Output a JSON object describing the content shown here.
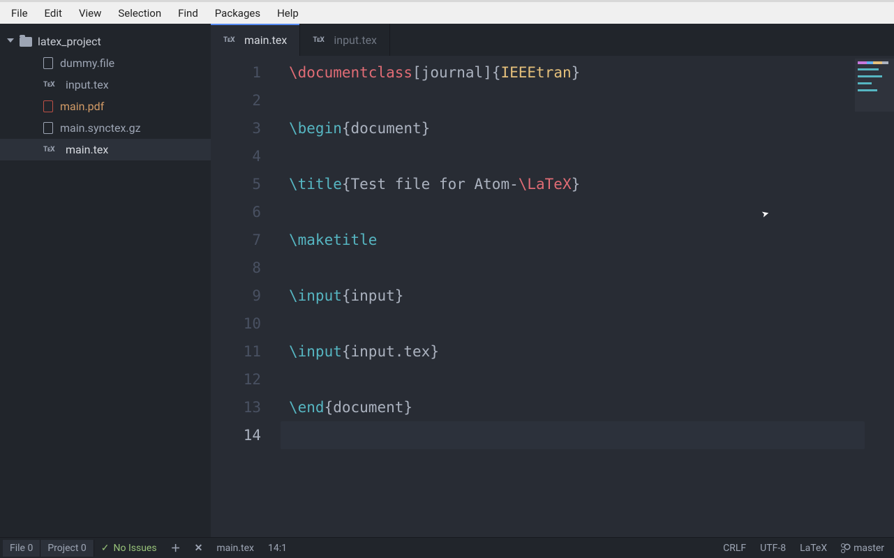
{
  "menubar": [
    "File",
    "Edit",
    "View",
    "Selection",
    "Find",
    "Packages",
    "Help"
  ],
  "sidebar": {
    "root": "latex_project",
    "files": [
      {
        "name": "dummy.file",
        "icon": "file",
        "selected": false
      },
      {
        "name": "input.tex",
        "icon": "tex",
        "selected": false
      },
      {
        "name": "main.pdf",
        "icon": "pdf",
        "selected": false
      },
      {
        "name": "main.synctex.gz",
        "icon": "gz",
        "selected": false
      },
      {
        "name": "main.tex",
        "icon": "tex",
        "selected": true
      }
    ]
  },
  "tabs": [
    {
      "label": "main.tex",
      "active": true
    },
    {
      "label": "input.tex",
      "active": false
    }
  ],
  "editor": {
    "tex_glyph": "TᴇX",
    "current_line": 14,
    "lines": [
      [
        {
          "t": "\\documentclass",
          "c": "red"
        },
        {
          "t": "[",
          "c": "bracket"
        },
        {
          "t": "journal",
          "c": "arg"
        },
        {
          "t": "]{",
          "c": "brace"
        },
        {
          "t": "IEEEtran",
          "c": "class"
        },
        {
          "t": "}",
          "c": "brace"
        }
      ],
      [],
      [
        {
          "t": "\\begin",
          "c": "cmd"
        },
        {
          "t": "{",
          "c": "brace"
        },
        {
          "t": "document",
          "c": "arg"
        },
        {
          "t": "}",
          "c": "brace"
        }
      ],
      [],
      [
        {
          "t": "\\title",
          "c": "cmd"
        },
        {
          "t": "{",
          "c": "brace"
        },
        {
          "t": "Test file for Atom-",
          "c": "arg"
        },
        {
          "t": "\\LaTeX",
          "c": "red"
        },
        {
          "t": "}",
          "c": "brace"
        }
      ],
      [],
      [
        {
          "t": "\\maketitle",
          "c": "cmd"
        }
      ],
      [],
      [
        {
          "t": "\\input",
          "c": "cmd"
        },
        {
          "t": "{",
          "c": "brace"
        },
        {
          "t": "input",
          "c": "arg"
        },
        {
          "t": "}",
          "c": "brace"
        }
      ],
      [],
      [
        {
          "t": "\\input",
          "c": "cmd"
        },
        {
          "t": "{",
          "c": "brace"
        },
        {
          "t": "input.tex",
          "c": "arg"
        },
        {
          "t": "}",
          "c": "brace"
        }
      ],
      [],
      [
        {
          "t": "\\end",
          "c": "cmd"
        },
        {
          "t": "{",
          "c": "brace"
        },
        {
          "t": "document",
          "c": "arg"
        },
        {
          "t": "}",
          "c": "brace"
        }
      ],
      []
    ]
  },
  "statusbar": {
    "file_btn": "File  0",
    "project_btn": "Project  0",
    "no_issues": "No Issues",
    "filename": "main.tex",
    "cursor": "14:1",
    "eol": "CRLF",
    "encoding": "UTF-8",
    "grammar": "LaTeX",
    "branch": "master"
  }
}
